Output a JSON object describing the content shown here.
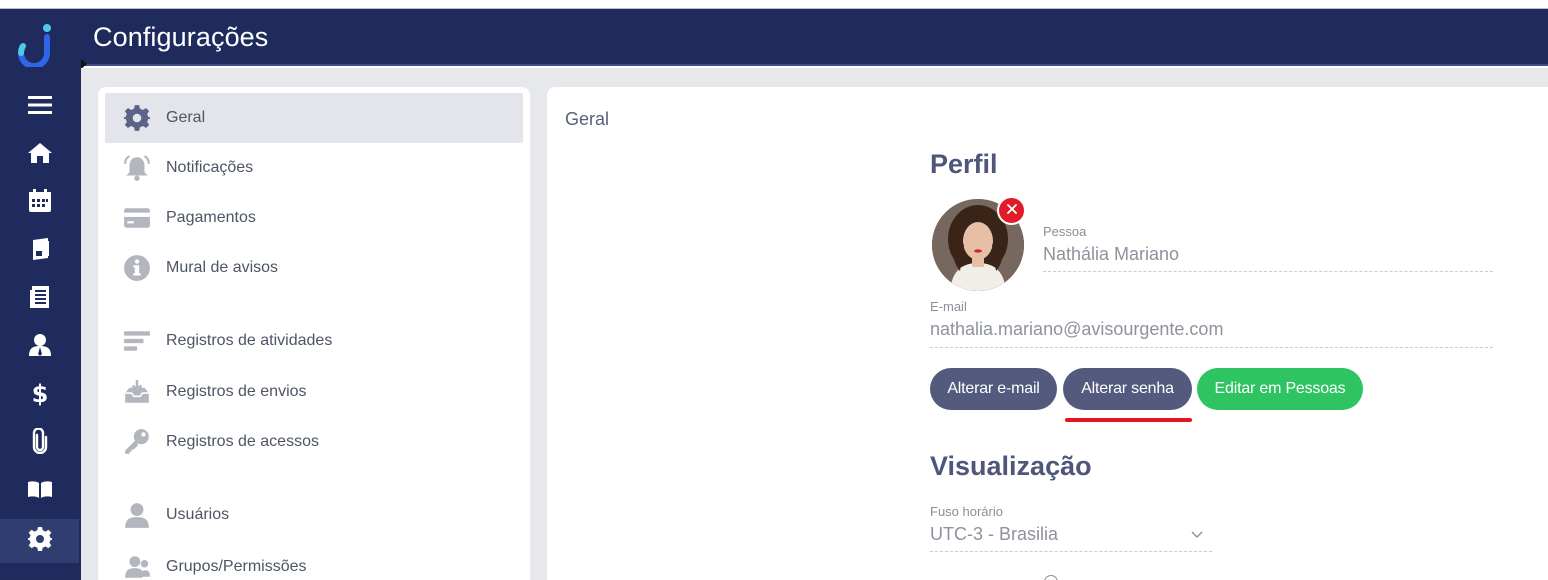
{
  "header": {
    "title": "Configurações"
  },
  "rail": {
    "items": [
      {
        "icon": "menu-icon"
      },
      {
        "icon": "home-icon"
      },
      {
        "icon": "calendar-icon"
      },
      {
        "icon": "document-icon"
      },
      {
        "icon": "list-document-icon"
      },
      {
        "icon": "user-icon"
      },
      {
        "icon": "dollar-icon"
      },
      {
        "icon": "paperclip-icon"
      },
      {
        "icon": "book-icon"
      },
      {
        "icon": "gear-icon"
      }
    ]
  },
  "settings_menu": {
    "items": [
      {
        "label": "Geral",
        "icon": "gear-icon",
        "active": true
      },
      {
        "label": "Notificações",
        "icon": "bell-icon"
      },
      {
        "label": "Pagamentos",
        "icon": "credit-card-icon"
      },
      {
        "label": "Mural de avisos",
        "icon": "info-icon"
      },
      {
        "label": "Registros de atividades",
        "icon": "lines-icon"
      },
      {
        "label": "Registros de envios",
        "icon": "inbox-icon"
      },
      {
        "label": "Registros de acessos",
        "icon": "key-icon"
      },
      {
        "label": "Usuários",
        "icon": "user-icon"
      },
      {
        "label": "Grupos/Permissões",
        "icon": "users-icon"
      }
    ]
  },
  "main": {
    "breadcrumb": "Geral",
    "profile": {
      "title": "Perfil",
      "person_label": "Pessoa",
      "person_value": "Nathália Mariano",
      "email_label": "E-mail",
      "email_value": "nathalia.mariano@avisourgente.com",
      "buttons": {
        "change_email": "Alterar e-mail",
        "change_password": "Alterar senha",
        "edit_in_people": "Editar em Pessoas"
      }
    },
    "visualization": {
      "title": "Visualização",
      "timezone_label": "Fuso horário",
      "timezone_value": "UTC-3 - Brasilia"
    }
  },
  "colors": {
    "brand_navy": "#1f2b5c",
    "button_gray": "#535a7d",
    "button_green": "#2dc461",
    "accent_red": "#e5141f"
  }
}
